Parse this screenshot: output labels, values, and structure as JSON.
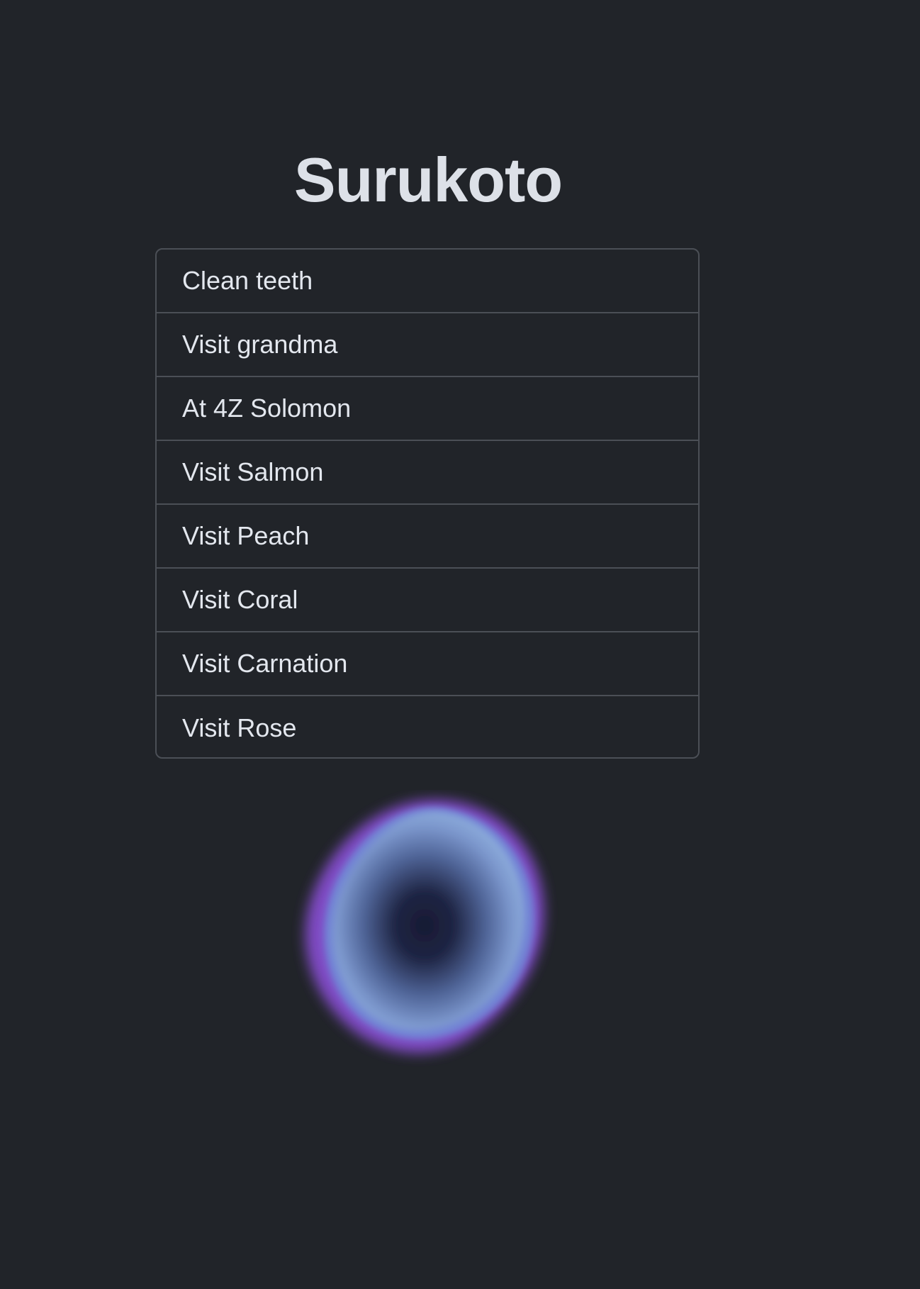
{
  "app": {
    "title": "Surukoto"
  },
  "tasks": [
    {
      "label": "Clean teeth"
    },
    {
      "label": "Visit grandma"
    },
    {
      "label": "At 4Z Solomon"
    },
    {
      "label": "Visit Salmon"
    },
    {
      "label": "Visit Peach"
    },
    {
      "label": "Visit Coral"
    },
    {
      "label": "Visit Carnation"
    },
    {
      "label": "Visit Rose"
    }
  ],
  "orb": {
    "icon": "voice-orb-icon",
    "colors": {
      "core": "#171a33",
      "body": "#7b96cc",
      "glow": "#8a4fd6"
    }
  },
  "theme": {
    "background": "#212429",
    "border": "#4b4f56",
    "text": "#e3e7ee"
  }
}
